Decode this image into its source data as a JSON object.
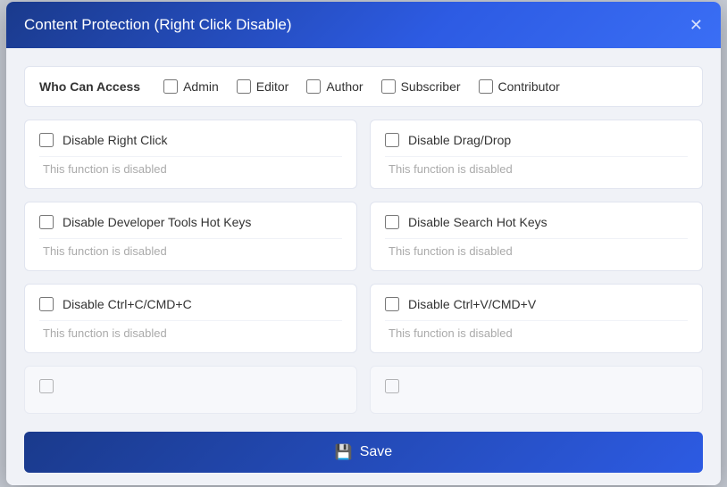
{
  "modal": {
    "title": "Content Protection (Right Click Disable)",
    "close_label": "✕"
  },
  "access": {
    "label": "Who Can Access",
    "roles": [
      {
        "id": "admin",
        "label": "Admin",
        "checked": false
      },
      {
        "id": "editor",
        "label": "Editor",
        "checked": false
      },
      {
        "id": "author",
        "label": "Author",
        "checked": false
      },
      {
        "id": "subscriber",
        "label": "Subscriber",
        "checked": false
      },
      {
        "id": "contributor",
        "label": "Contributor",
        "checked": false
      }
    ]
  },
  "features": [
    {
      "id": "disable-right-click",
      "label": "Disable Right Click",
      "status": "This function is disabled",
      "checked": false
    },
    {
      "id": "disable-drag-drop",
      "label": "Disable Drag/Drop",
      "status": "This function is disabled",
      "checked": false
    },
    {
      "id": "disable-dev-tools",
      "label": "Disable Developer Tools Hot Keys",
      "status": "This function is disabled",
      "checked": false
    },
    {
      "id": "disable-search-hotkeys",
      "label": "Disable Search Hot Keys",
      "status": "This function is disabled",
      "checked": false
    },
    {
      "id": "disable-ctrl-c",
      "label": "Disable Ctrl+C/CMD+C",
      "status": "This function is disabled",
      "checked": false
    },
    {
      "id": "disable-ctrl-v",
      "label": "Disable Ctrl+V/CMD+V",
      "status": "This function is disabled",
      "checked": false
    },
    {
      "id": "feature-partial-left",
      "label": "",
      "status": "",
      "checked": false
    },
    {
      "id": "feature-partial-right",
      "label": "",
      "status": "",
      "checked": false
    }
  ],
  "footer": {
    "save_label": "Save",
    "save_icon": "💾"
  }
}
